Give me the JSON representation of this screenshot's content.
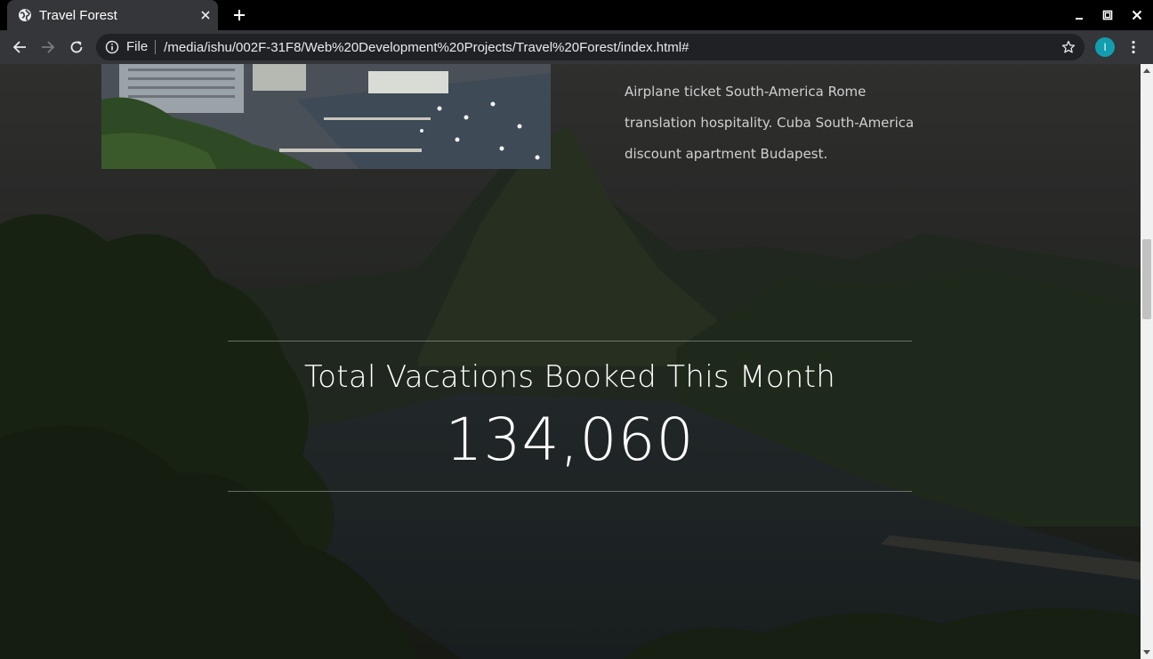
{
  "browser": {
    "tab": {
      "title": "Travel Forest",
      "favicon": "globe-icon"
    },
    "new_tab_icon": "plus-icon",
    "window_controls": [
      "minimize-icon",
      "maximize-icon",
      "close-icon"
    ],
    "omnibox": {
      "scheme_label": "File",
      "url": "/media/ishu/002F-31F8/Web%20Development%20Projects/Travel%20Forest/index.html#"
    },
    "profile_initial": "I",
    "colors": {
      "tabstrip": "#000000",
      "toolbar": "#35363a",
      "omnibox": "#202124",
      "profile": "#129eaf"
    }
  },
  "page": {
    "feature_paragraph": "Airplane ticket South-America Rome translation hospitality. Cuba South-America discount apartment Budapest.",
    "stats": {
      "heading": "Total Vacations Booked This Month",
      "count": "134,060"
    },
    "colors": {
      "text_primary": "#ffffff",
      "text_secondary": "#d0d0d0",
      "divider": "rgba(255,255,255,0.35)"
    }
  }
}
